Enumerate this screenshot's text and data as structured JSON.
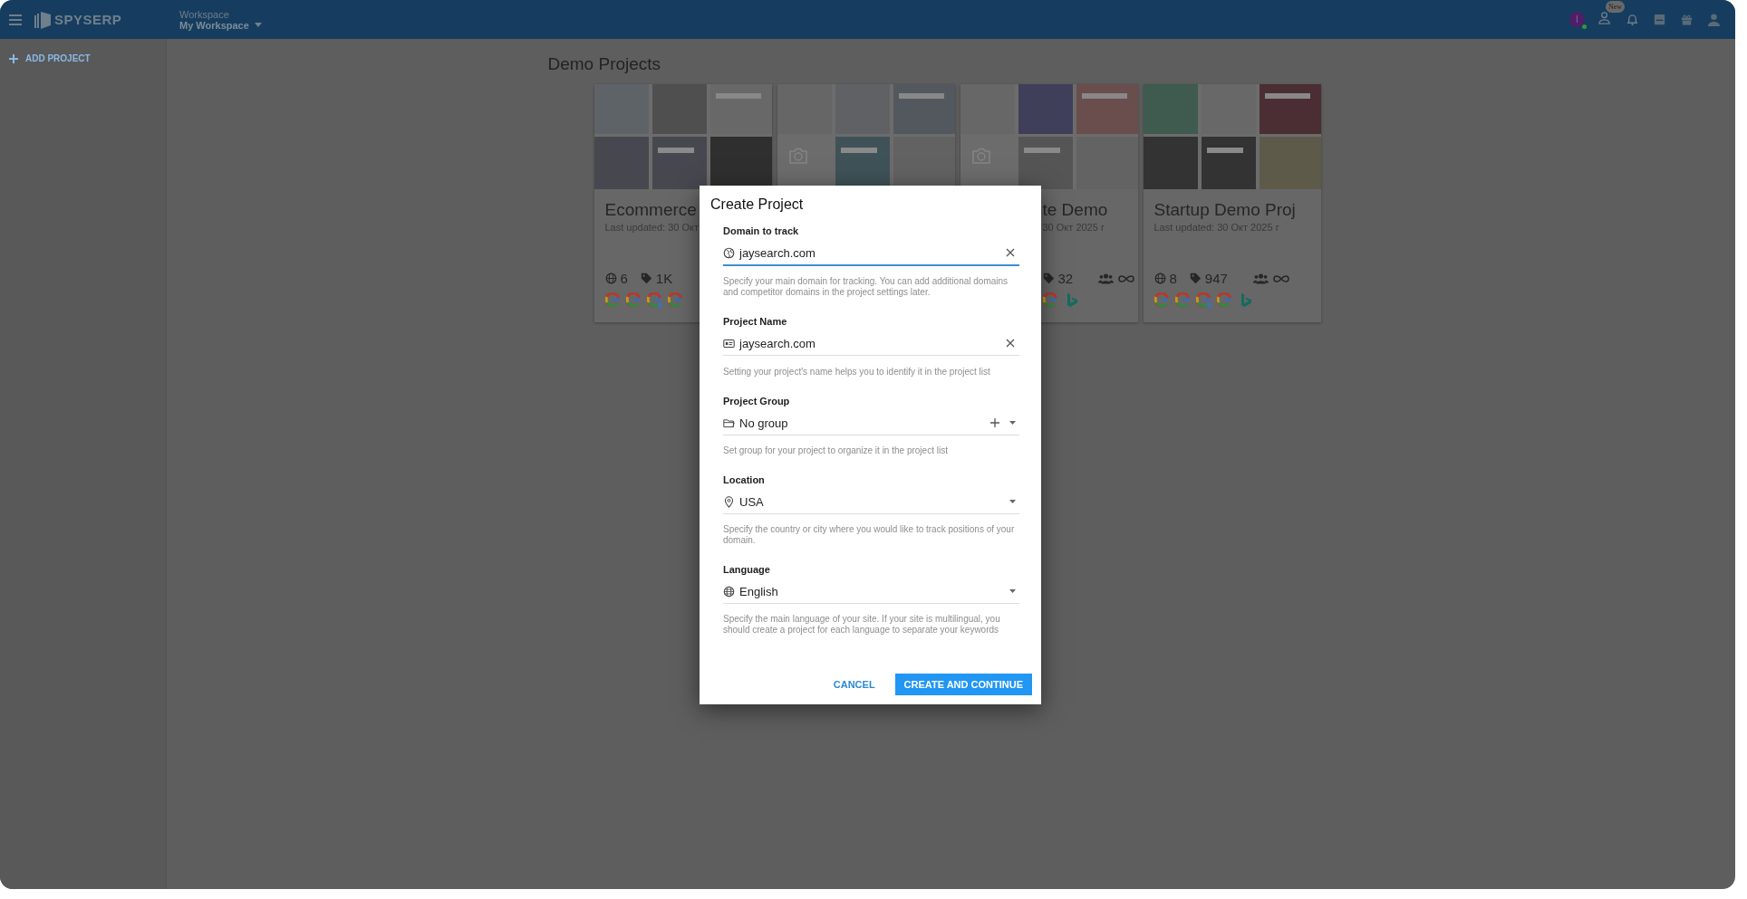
{
  "top_bar": {
    "logo": "SPYSERP",
    "workspace_label": "Workspace",
    "workspace_name": "My Workspace",
    "avatar_initial": "I",
    "badge": "New"
  },
  "sidebar": {
    "add_project": "ADD PROJECT"
  },
  "page_title": "Demo Projects",
  "cards": [
    {
      "kind": "left_part",
      "title": "Ecommerce",
      "updated": "Last updated: 30 Окт",
      "sites": "6",
      "keywords": "1K",
      "camera": false,
      "engines": [
        {
          "kind": "google"
        },
        {
          "kind": "google"
        },
        {
          "kind": "google_mobile"
        },
        {
          "kind": "google"
        }
      ]
    },
    {
      "kind": "hidden",
      "camera": true
    },
    {
      "kind": "right_part",
      "title": "te Demo",
      "updated": "30 Окт 2025 г",
      "keywords": "32",
      "camera": true,
      "engines": [
        {
          "kind": "google"
        },
        {
          "kind": "bing"
        }
      ]
    },
    {
      "kind": "full",
      "title": "Startup Demo Proj",
      "updated": "Last updated: 30 Окт 2025 г",
      "sites": "8",
      "keywords": "947",
      "camera": false,
      "engines": [
        {
          "kind": "google"
        },
        {
          "kind": "google"
        },
        {
          "kind": "google_mobile"
        },
        {
          "kind": "google"
        },
        {
          "kind": "bing"
        }
      ]
    }
  ],
  "dialog": {
    "title": "Create Project",
    "fields": [
      {
        "kind": "text",
        "label": "Domain to track",
        "value": "jaysearch.com",
        "focused": true,
        "hint": "Specify your main domain for tracking. You can add additional domains and competitor domains in the project settings later."
      },
      {
        "kind": "text",
        "label": "Project Name",
        "value": "jaysearch.com",
        "focused": false,
        "hint": "Setting your project's name helps you to identify it in the project list"
      },
      {
        "kind": "select",
        "label": "Project Group",
        "value": "No group",
        "addable": true,
        "hint": "Set group for your project to organize it in the project list"
      },
      {
        "kind": "select",
        "label": "Location",
        "value": "USA",
        "addable": false,
        "hint": "Specify the country or city where you would like to track positions of your domain."
      },
      {
        "kind": "select",
        "label": "Language",
        "value": "English",
        "addable": false,
        "hint": "Specify the main language of your site. If your site is multilingual, you should create a project for each language to separate your keywords"
      }
    ],
    "cancel": "CANCEL",
    "submit": "CREATE AND CONTINUE"
  }
}
